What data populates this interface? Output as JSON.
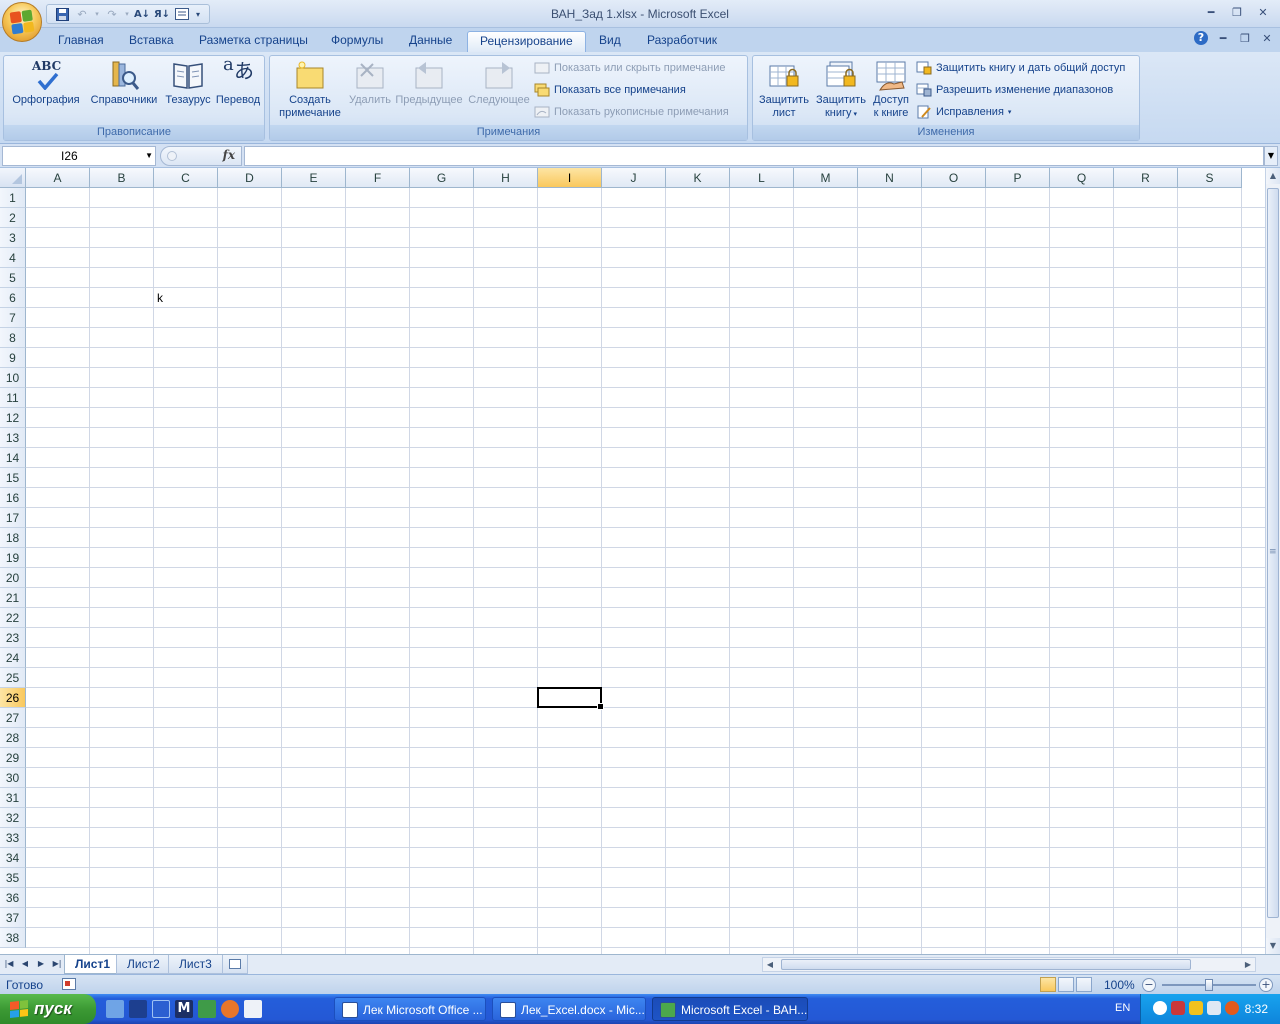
{
  "window": {
    "title": "ВАН_Зад 1.xlsx - Microsoft Excel"
  },
  "ribbon_tabs": [
    {
      "label": "Главная",
      "active": false
    },
    {
      "label": "Вставка",
      "active": false
    },
    {
      "label": "Разметка страницы",
      "active": false
    },
    {
      "label": "Формулы",
      "active": false
    },
    {
      "label": "Данные",
      "active": false
    },
    {
      "label": "Рецензирование",
      "active": true
    },
    {
      "label": "Вид",
      "active": false
    },
    {
      "label": "Разработчик",
      "active": false
    }
  ],
  "groups": {
    "proofing": {
      "label": "Правописание",
      "spelling": "Орфография",
      "research": "Справочники",
      "thesaurus": "Тезаурус",
      "translate": "Перевод"
    },
    "comments": {
      "label": "Примечания",
      "new_comment_l1": "Создать",
      "new_comment_l2": "примечание",
      "delete": "Удалить",
      "previous": "Предыдущее",
      "next": "Следующее",
      "show_hide": "Показать или скрыть примечание",
      "show_all": "Показать все примечания",
      "show_ink": "Показать рукописные примечания"
    },
    "changes": {
      "label": "Изменения",
      "protect_sheet_l1": "Защитить",
      "protect_sheet_l2": "лист",
      "protect_workbook_l1": "Защитить",
      "protect_workbook_l2": "книгу",
      "share_l1": "Доступ",
      "share_l2": "к книге",
      "protect_share": "Защитить книгу и дать общий доступ",
      "allow_ranges": "Разрешить изменение диапазонов",
      "track_changes": "Исправления"
    }
  },
  "formula_bar": {
    "name_box": "I26",
    "fx": "fx",
    "formula": ""
  },
  "columns": [
    "A",
    "B",
    "C",
    "D",
    "E",
    "F",
    "G",
    "H",
    "I",
    "J",
    "K",
    "L",
    "M",
    "N",
    "O",
    "P",
    "Q",
    "R",
    "S"
  ],
  "rows": [
    "1",
    "2",
    "3",
    "4",
    "5",
    "6",
    "7",
    "8",
    "9",
    "10",
    "11",
    "12",
    "13",
    "14",
    "15",
    "16",
    "17",
    "18",
    "19",
    "20",
    "21",
    "22",
    "23",
    "24",
    "25",
    "26",
    "27",
    "28",
    "29",
    "30",
    "31",
    "32",
    "33",
    "34",
    "35",
    "36",
    "37",
    "38"
  ],
  "selected": {
    "column": "I",
    "row": "26"
  },
  "cells": [
    {
      "ref": "C6",
      "value": "k"
    }
  ],
  "sheets": [
    {
      "label": "Лист1",
      "active": true
    },
    {
      "label": "Лист2",
      "active": false
    },
    {
      "label": "Лист3",
      "active": false
    }
  ],
  "status": {
    "ready": "Готово",
    "zoom": "100%",
    "zoom_fraction": 0.5
  },
  "taskbar": {
    "start": "пуск",
    "tasks": [
      {
        "label": "Лек Microsoft Office ...",
        "active": false
      },
      {
        "label": "Лек_Excel.docx - Mic...",
        "active": false
      },
      {
        "label": "Microsoft Excel - ВАН...",
        "active": true
      }
    ],
    "lang": "EN",
    "time": "8:32"
  },
  "colors": {
    "accent": "#15428b",
    "selection": "#f9c85d",
    "ribbon": "#c6d9f1"
  }
}
